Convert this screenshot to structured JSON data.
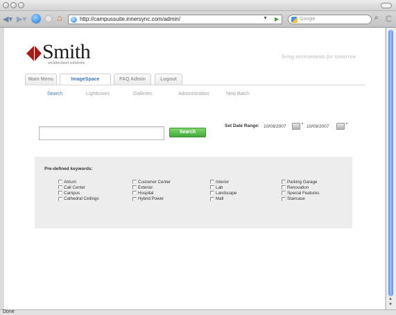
{
  "browser": {
    "url": "http://campussuite.innersync.com/admin/",
    "search_placeholder": "Google",
    "status": "Done"
  },
  "brand": {
    "name": "Smith",
    "subtitle": "architectural solutions",
    "tagline": "living environments for tomorrow",
    "mark_color": "#a31c17"
  },
  "tabs": [
    "Main Menu",
    "ImageSpace",
    "FAQ Admin",
    "Logout"
  ],
  "active_tab": "ImageSpace",
  "subnav": [
    "Search",
    "Lightboxes",
    "Galleries",
    "Administration",
    "New Batch"
  ],
  "active_subnav": "Search",
  "search": {
    "value": "",
    "button_label": "Search"
  },
  "date_range": {
    "label": "Set Date Range:",
    "from": "10/09/2007",
    "to": "10/09/2007"
  },
  "keywords": {
    "title": "Pre-defined keywords:",
    "columns": [
      [
        "Atrium",
        "Call Center",
        "Campus",
        "Cathedral Ceilings"
      ],
      [
        "Customer Center",
        "Exterior",
        "Hospital",
        "Hybrid Power"
      ],
      [
        "Interior",
        "Lab",
        "Landscape",
        "Mall"
      ],
      [
        "Parking Garage",
        "Renovation",
        "Special Features",
        "Staircase"
      ]
    ]
  },
  "colors": {
    "link_blue": "#3f77b7",
    "search_green": "#4cae3f",
    "panel_gray": "#ededed"
  }
}
